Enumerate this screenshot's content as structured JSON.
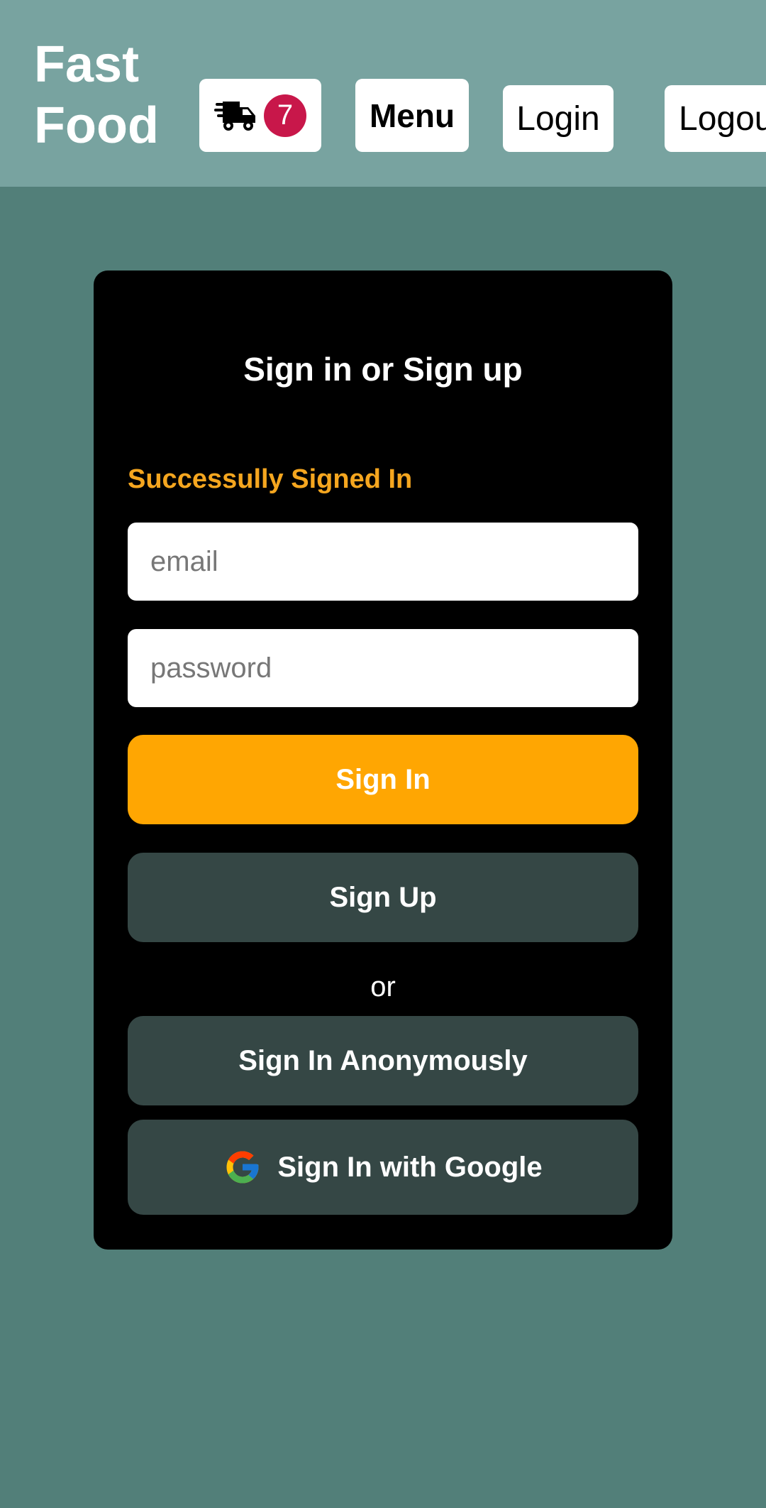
{
  "header": {
    "brand": "Fast\nFood",
    "cart_count": "7",
    "menu_label": "Menu",
    "login_label": "Login",
    "logout_label": "Logout"
  },
  "auth": {
    "title": "Sign in or Sign up",
    "status": "Successully Signed In",
    "email_placeholder": "email",
    "password_placeholder": "password",
    "sign_in_label": "Sign In",
    "sign_up_label": "Sign Up",
    "or_label": "or",
    "anonymous_label": "Sign In Anonymously",
    "google_label": "Sign In with Google"
  },
  "icons": {
    "cart": "truck-icon",
    "google": "google-icon"
  },
  "colors": {
    "header_bg": "#78a3a0",
    "page_bg": "#527f79",
    "card_bg": "#000000",
    "accent": "#ffa602",
    "status": "#f5a61f",
    "secondary_button": "#354745",
    "badge": "#c8174a"
  }
}
